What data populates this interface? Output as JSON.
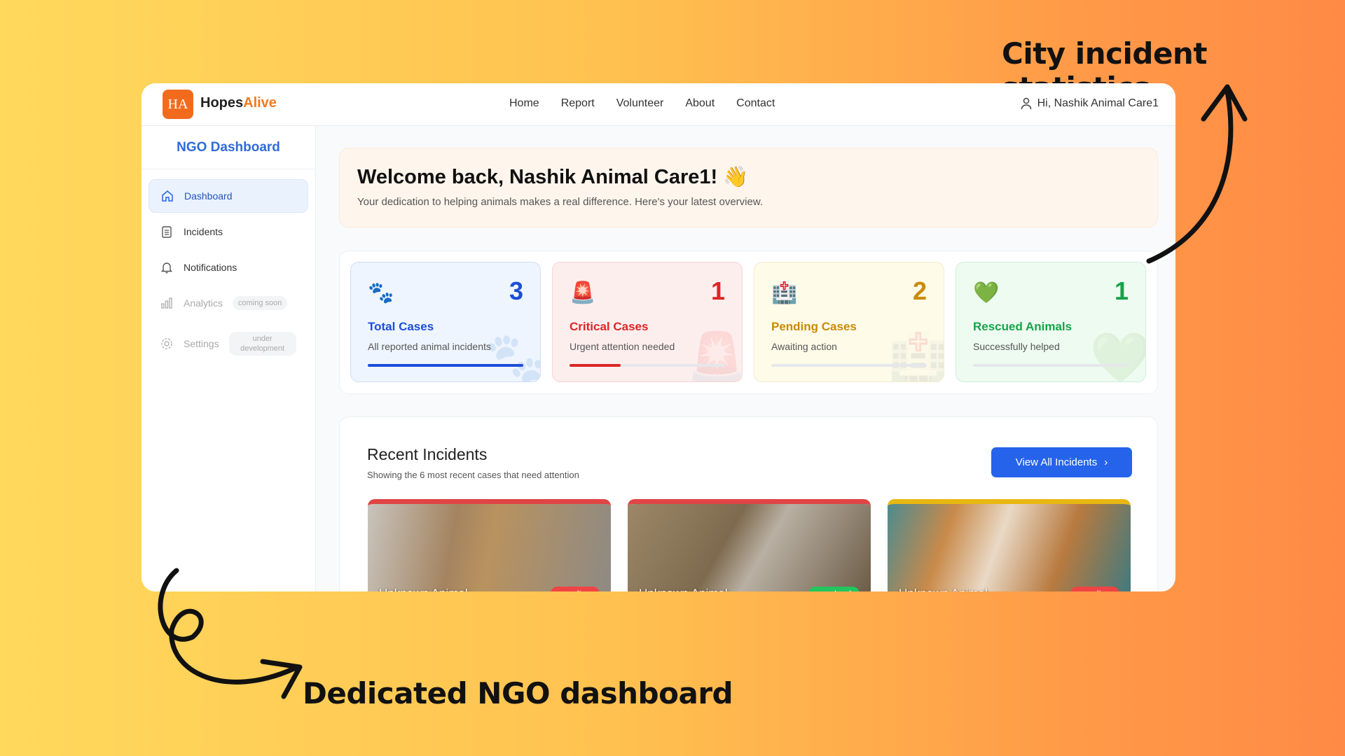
{
  "annotations": {
    "top": "City incident statistics",
    "bottom": "Dedicated NGO dashboard"
  },
  "header": {
    "logo": "HA",
    "brand_1": "Hopes",
    "brand_2": "Alive",
    "nav": [
      "Home",
      "Report",
      "Volunteer",
      "About",
      "Contact"
    ],
    "user": "Hi, Nashik Animal Care1"
  },
  "sidebar": {
    "title": "NGO Dashboard",
    "items": [
      {
        "label": "Dashboard",
        "icon": "home-icon"
      },
      {
        "label": "Incidents",
        "icon": "clipboard-icon"
      },
      {
        "label": "Notifications",
        "icon": "bell-icon"
      },
      {
        "label": "Analytics",
        "icon": "bar-chart-icon",
        "badge": "coming soon"
      },
      {
        "label": "Settings",
        "icon": "gear-icon",
        "badge": "under development"
      }
    ]
  },
  "welcome": {
    "title": "Welcome back, Nashik Animal Care1! 👋",
    "subtitle": "Your dedication to helping animals makes a real difference. Here's your latest overview."
  },
  "stats": [
    {
      "icon": "🐾",
      "value": "3",
      "label": "Total Cases",
      "sub": "All reported animal incidents",
      "color": "#1d4ed8",
      "bg": "#eef5fe",
      "progress": 100
    },
    {
      "icon": "🚨",
      "value": "1",
      "label": "Critical Cases",
      "sub": "Urgent attention needed",
      "color": "#dc2626",
      "bg": "#fdeeee",
      "progress": 33
    },
    {
      "icon": "🏥",
      "value": "2",
      "label": "Pending Cases",
      "sub": "Awaiting action",
      "color": "#ca8a04",
      "bg": "#fefbe9",
      "progress": 0
    },
    {
      "icon": "💚",
      "value": "1",
      "label": "Rescued Animals",
      "sub": "Successfully helped",
      "color": "#16a34a",
      "bg": "#edfbf1",
      "progress": 0
    }
  ],
  "recent": {
    "title": "Recent Incidents",
    "subtitle": "Showing the 6 most recent cases that need attention",
    "button": "View All Incidents",
    "incidents": [
      {
        "name": "Unknown Animal",
        "status": "pending",
        "status_color": "#ef4444",
        "accent": "#e04444"
      },
      {
        "name": "Unknown Animal",
        "status": "resolved",
        "status_color": "#22c55e",
        "accent": "#e04444"
      },
      {
        "name": "Unknown Animal",
        "status": "pending",
        "status_color": "#ef4444",
        "accent": "#e8b812"
      }
    ]
  }
}
